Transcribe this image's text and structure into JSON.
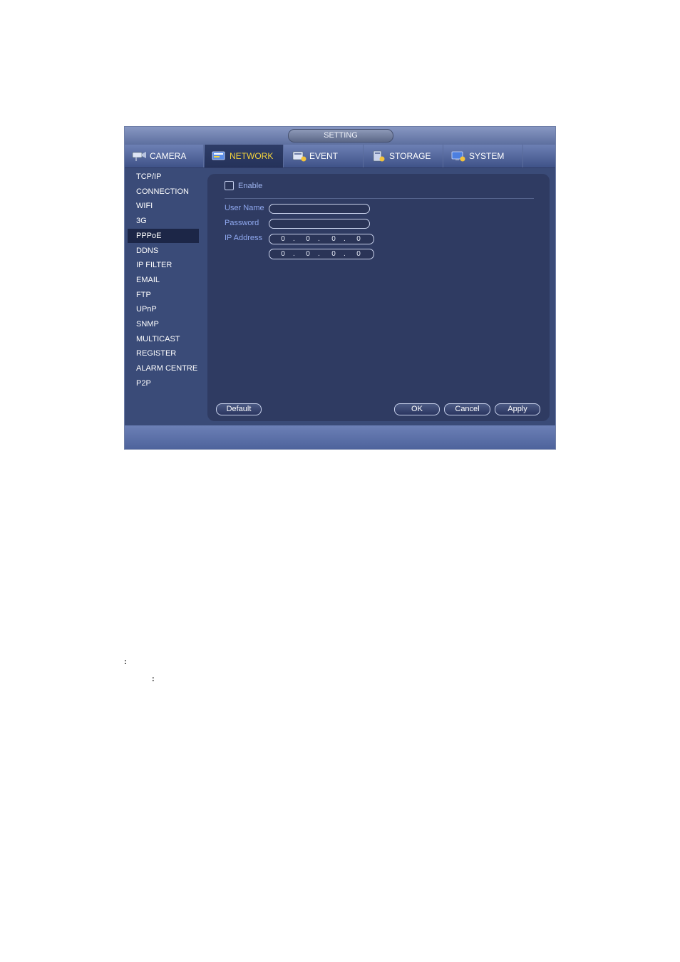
{
  "window": {
    "title": "SETTING"
  },
  "tabs": [
    {
      "label": "CAMERA",
      "icon": "camera-icon"
    },
    {
      "label": "NETWORK",
      "icon": "network-icon",
      "active": true
    },
    {
      "label": "EVENT",
      "icon": "event-icon"
    },
    {
      "label": "STORAGE",
      "icon": "storage-icon"
    },
    {
      "label": "SYSTEM",
      "icon": "system-icon"
    }
  ],
  "sidebar": {
    "items": [
      "TCP/IP",
      "CONNECTION",
      "WIFI",
      "3G",
      "PPPoE",
      "DDNS",
      "IP FILTER",
      "EMAIL",
      "FTP",
      "UPnP",
      "SNMP",
      "MULTICAST",
      "REGISTER",
      "ALARM CENTRE",
      "P2P"
    ],
    "active": "PPPoE"
  },
  "form": {
    "enable_label": "Enable",
    "enable_checked": false,
    "username_label": "User Name",
    "username_value": "",
    "password_label": "Password",
    "password_value": "",
    "ip_label": "IP Address",
    "ip1": [
      "0",
      "0",
      "0",
      "0"
    ],
    "ip2": [
      "0",
      "0",
      "0",
      "0"
    ]
  },
  "buttons": {
    "default": "Default",
    "ok": "OK",
    "cancel": "Cancel",
    "apply": "Apply"
  },
  "notes": [
    ":",
    ":"
  ],
  "colors": {
    "accent": "#f3d33b",
    "panel": "#2f3b62",
    "label": "#8fa8ef"
  }
}
